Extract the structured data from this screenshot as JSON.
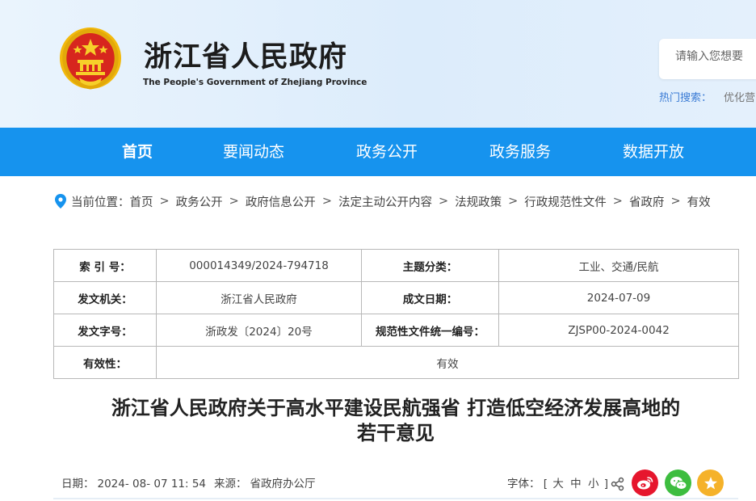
{
  "header": {
    "title": "浙江省人民政府",
    "subtitle": "The People's Government of Zhejiang Province",
    "search_placeholder": "请输入您想要",
    "hot_search_label": "热门搜索：",
    "hot_search_item": "优化营"
  },
  "nav": {
    "items": [
      {
        "label": "首页",
        "active": true
      },
      {
        "label": "要闻动态",
        "active": false
      },
      {
        "label": "政务公开",
        "active": false
      },
      {
        "label": "政务服务",
        "active": false
      },
      {
        "label": "数据开放",
        "active": false
      }
    ]
  },
  "breadcrumb": {
    "prefix": "当前位置：",
    "items": [
      "首页",
      "政务公开",
      "政府信息公开",
      "法定主动公开内容",
      "法规政策",
      "行政规范性文件",
      "省政府",
      "有效"
    ]
  },
  "info": {
    "index_label": "索 引 号：",
    "index_value": "000014349/2024-794718",
    "topic_label": "主题分类：",
    "topic_value": "工业、交通/民航",
    "issuer_label": "发文机关：",
    "issuer_value": "浙江省人民政府",
    "date_label": "成文日期：",
    "date_value": "2024-07-09",
    "docno_label": "发文字号：",
    "docno_value": "浙政发〔2024〕20号",
    "code_label": "规范性文件统一编号：",
    "code_value": "ZJSP00-2024-0042",
    "validity_label": "有效性：",
    "validity_value": "有效"
  },
  "article": {
    "title_line1": "浙江省人民政府关于高水平建设民航强省 打造低空经济发展高地的",
    "title_line2": "若干意见",
    "date_label": "日期：",
    "date_value": "2024- 08- 07 11: 54",
    "source_label": "来源：",
    "source_value": "省政府办公厅",
    "fontsize_label": "字体：",
    "fontsize_open": "[",
    "fontsize_large": "大",
    "fontsize_medium": "中",
    "fontsize_small": "小",
    "fontsize_close": "]"
  },
  "colors": {
    "nav_bg": "#1693ee",
    "header_bg": "#dcecfb",
    "weibo": "#e6162d",
    "wechat": "#3dbd3f",
    "favorite": "#f5b22a",
    "link_blue": "#3a7bd5"
  },
  "icons": [
    "national-emblem-icon",
    "location-pin-icon",
    "share-icon",
    "weibo-icon",
    "wechat-icon",
    "star-icon"
  ]
}
